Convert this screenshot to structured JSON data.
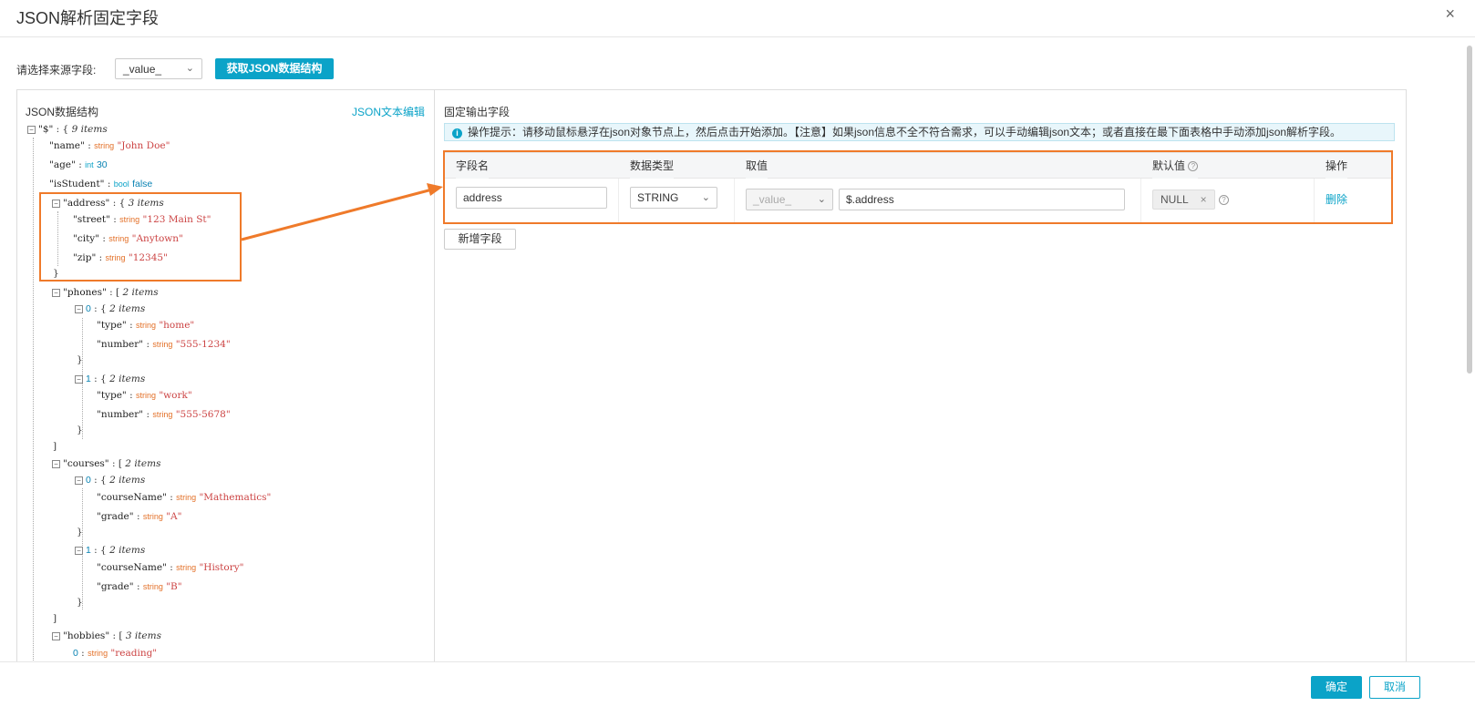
{
  "dialog": {
    "title": "JSON解析固定字段",
    "close": "×"
  },
  "source": {
    "label": "请选择来源字段:",
    "value": "_value_",
    "fetch_button": "获取JSON数据结构"
  },
  "left": {
    "heading": "JSON数据结构",
    "edit_link": "JSON文本编辑"
  },
  "tree": {
    "root": {
      "key": "\"$\"",
      "count": "9 items"
    },
    "name": {
      "key": "\"name\"",
      "type": "string",
      "value": "\"John Doe\""
    },
    "age": {
      "key": "\"age\"",
      "type": "int",
      "value": "30"
    },
    "isStudent": {
      "key": "\"isStudent\"",
      "type": "bool",
      "value": "false"
    },
    "address": {
      "key": "\"address\"",
      "count": "3 items",
      "street": {
        "key": "\"street\"",
        "type": "string",
        "value": "\"123 Main St\""
      },
      "city": {
        "key": "\"city\"",
        "type": "string",
        "value": "\"Anytown\""
      },
      "zip": {
        "key": "\"zip\"",
        "type": "string",
        "value": "\"12345\""
      }
    },
    "phones": {
      "key": "\"phones\"",
      "count": "2 items",
      "p0": {
        "idx": "0",
        "count": "2 items",
        "type": {
          "key": "\"type\"",
          "type": "string",
          "value": "\"home\""
        },
        "number": {
          "key": "\"number\"",
          "type": "string",
          "value": "\"555-1234\""
        }
      },
      "p1": {
        "idx": "1",
        "count": "2 items",
        "type": {
          "key": "\"type\"",
          "type": "string",
          "value": "\"work\""
        },
        "number": {
          "key": "\"number\"",
          "type": "string",
          "value": "\"555-5678\""
        }
      }
    },
    "courses": {
      "key": "\"courses\"",
      "count": "2 items",
      "c0": {
        "idx": "0",
        "count": "2 items",
        "courseName": {
          "key": "\"courseName\"",
          "type": "string",
          "value": "\"Mathematics\""
        },
        "grade": {
          "key": "\"grade\"",
          "type": "string",
          "value": "\"A\""
        }
      },
      "c1": {
        "idx": "1",
        "count": "2 items",
        "courseName": {
          "key": "\"courseName\"",
          "type": "string",
          "value": "\"History\""
        },
        "grade": {
          "key": "\"grade\"",
          "type": "string",
          "value": "\"B\""
        }
      }
    },
    "hobbies": {
      "key": "\"hobbies\"",
      "count": "3 items",
      "h0": {
        "idx": "0",
        "type": "string",
        "value": "\"reading\""
      }
    }
  },
  "right": {
    "heading": "固定输出字段",
    "tip": "操作提示：请移动鼠标悬浮在json对象节点上，然后点击开始添加。【注意】如果json信息不全不符合需求，可以手动编辑json文本；或者直接在最下面表格中手动添加json解析字段。",
    "columns": {
      "name": "字段名",
      "type": "数据类型",
      "value": "取值",
      "default": "默认值",
      "action": "操作"
    },
    "row": {
      "name": "address",
      "type": "STRING",
      "source": "_value_",
      "path": "$.address",
      "default": "NULL",
      "delete": "删除"
    },
    "add_button": "新增字段"
  },
  "footer": {
    "ok": "确定",
    "cancel": "取消"
  },
  "colors": {
    "accent": "#0ba3c8",
    "highlight": "#ef7a2a"
  }
}
